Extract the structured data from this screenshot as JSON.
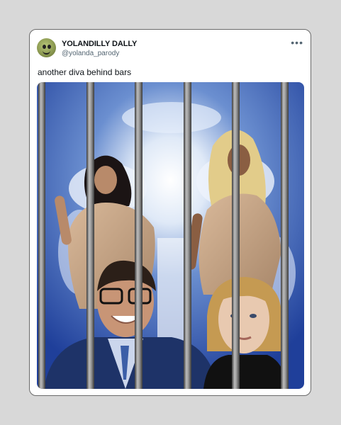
{
  "post": {
    "display_name": "YOLANDILLY DALLY",
    "handle": "@yolanda_parody",
    "text": "another diva behind bars",
    "more_icon": "more-horizontal-icon"
  },
  "colors": {
    "sky_blue": "#2a52b0",
    "bar_gray": "#8a8a8a",
    "handle_gray": "#536471"
  }
}
